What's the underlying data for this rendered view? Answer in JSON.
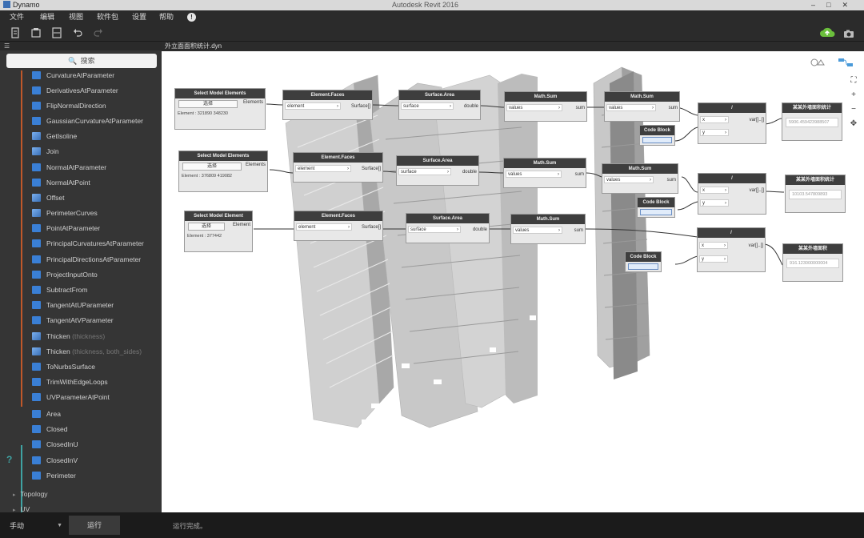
{
  "window": {
    "app_title": "Dynamo",
    "center_title": "Autodesk Revit 2016"
  },
  "menu": [
    {
      "label": "文件"
    },
    {
      "label": "编辑"
    },
    {
      "label": "视图"
    },
    {
      "label": "软件包"
    },
    {
      "label": "设置"
    },
    {
      "label": "帮助"
    }
  ],
  "toolbar": {
    "icons": [
      "new-file-icon",
      "open-icon",
      "save-icon",
      "undo-icon",
      "redo-icon"
    ],
    "cloud_color": "#6bbf3c"
  },
  "library": {
    "search_placeholder": "搜索",
    "items": [
      {
        "label": "CurvatureAtParameter",
        "dim": ""
      },
      {
        "label": "DerivativesAtParameter",
        "dim": ""
      },
      {
        "label": "FlipNormalDirection",
        "dim": ""
      },
      {
        "label": "GaussianCurvatureAtParameter",
        "dim": ""
      },
      {
        "label": "GetIsoline",
        "dim": ""
      },
      {
        "label": "Join",
        "dim": ""
      },
      {
        "label": "NormalAtParameter",
        "dim": ""
      },
      {
        "label": "NormalAtPoint",
        "dim": ""
      },
      {
        "label": "Offset",
        "dim": ""
      },
      {
        "label": "PerimeterCurves",
        "dim": ""
      },
      {
        "label": "PointAtParameter",
        "dim": ""
      },
      {
        "label": "PrincipalCurvaturesAtParameter",
        "dim": ""
      },
      {
        "label": "PrincipalDirectionsAtParameter",
        "dim": ""
      },
      {
        "label": "ProjectInputOnto",
        "dim": ""
      },
      {
        "label": "SubtractFrom",
        "dim": ""
      },
      {
        "label": "TangentAtUParameter",
        "dim": ""
      },
      {
        "label": "TangentAtVParameter",
        "dim": ""
      },
      {
        "label": "Thicken",
        "dim": " (thickness)"
      },
      {
        "label": "Thicken",
        "dim": " (thickness, both_sides)"
      },
      {
        "label": "ToNurbsSurface",
        "dim": ""
      },
      {
        "label": "TrimWithEdgeLoops",
        "dim": ""
      },
      {
        "label": "UVParameterAtPoint",
        "dim": ""
      }
    ],
    "query_items": [
      {
        "label": "Area"
      },
      {
        "label": "Closed"
      },
      {
        "label": "ClosedInU"
      },
      {
        "label": "ClosedInV"
      },
      {
        "label": "Perimeter"
      }
    ],
    "categories": [
      {
        "label": "Topology"
      },
      {
        "label": "UV"
      }
    ],
    "accent_create": "#c0582a",
    "accent_query": "#3fa3a3"
  },
  "tab": {
    "name": "外立面面积统计.dyn"
  },
  "nodes": {
    "sme1": {
      "title": "Select Model Elements",
      "button": "选择",
      "out": "Elements",
      "value": "Element : 321890 348230"
    },
    "sme2": {
      "title": "Select Model Elements",
      "button": "选择",
      "out": "Elements",
      "value": "Element : 376809 419082"
    },
    "sme3": {
      "title": "Select Model Element",
      "button": "选择",
      "out": "Element",
      "value": "Element : 377442"
    },
    "ef1": {
      "title": "Element.Faces",
      "in": "element",
      "out": "Surface[]"
    },
    "ef2": {
      "title": "Element.Faces",
      "in": "element",
      "out": "Surface[]"
    },
    "ef3": {
      "title": "Element.Faces",
      "in": "element",
      "out": "Surface[]"
    },
    "sa1": {
      "title": "Surface.Area",
      "in": "surface",
      "out": "double"
    },
    "sa2": {
      "title": "Surface.Area",
      "in": "surface",
      "out": "double"
    },
    "sa3": {
      "title": "Surface.Area",
      "in": "surface",
      "out": "double"
    },
    "ms1": {
      "title": "Math.Sum",
      "in": "values",
      "out": "sum"
    },
    "ms2": {
      "title": "Math.Sum",
      "in": "values",
      "out": "sum"
    },
    "ms3": {
      "title": "Math.Sum",
      "in": "values",
      "out": "sum"
    },
    "ms4": {
      "title": "Math.Sum",
      "in": "values",
      "out": "sum"
    },
    "ms5": {
      "title": "Math.Sum",
      "in": "values",
      "out": "sum"
    },
    "cb1": {
      "title": "Code Block"
    },
    "cb2": {
      "title": "Code Block"
    },
    "cb3": {
      "title": "Code Block"
    },
    "div1": {
      "title": "/",
      "in_x": "x",
      "in_y": "y",
      "out": "var[]..[]"
    },
    "div2": {
      "title": "/",
      "in_x": "x",
      "in_y": "y",
      "out": "var[]..[]"
    },
    "div3": {
      "title": "/",
      "in_x": "x",
      "in_y": "y",
      "out": "var[]..[]"
    },
    "w1": {
      "title": "某某外墙面积统计",
      "value": "5906.459423988507"
    },
    "w2": {
      "title": "某某外墙面积统计",
      "value": "10103.547809893"
    },
    "w3": {
      "title": "某某外墙面积",
      "value": "916.123000000004"
    }
  },
  "bottom": {
    "run_mode": "手动",
    "run_label": "运行",
    "status": "运行完成。"
  }
}
